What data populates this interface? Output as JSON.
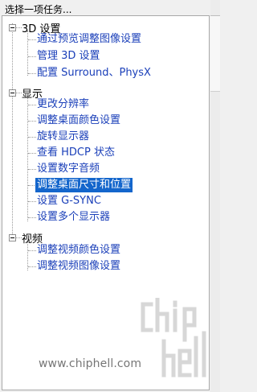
{
  "header": {
    "title": "选择一项任务..."
  },
  "tree": {
    "categories": [
      {
        "label": "3D 设置",
        "items": [
          {
            "label": "通过预览调整图像设置"
          },
          {
            "label": "管理 3D 设置"
          },
          {
            "label": "配置 Surround、PhysX"
          }
        ]
      },
      {
        "label": "显示",
        "items": [
          {
            "label": "更改分辨率"
          },
          {
            "label": "调整桌面颜色设置"
          },
          {
            "label": "旋转显示器"
          },
          {
            "label": "查看 HDCP 状态"
          },
          {
            "label": "设置数字音频"
          },
          {
            "label": "调整桌面尺寸和位置",
            "selected": true
          },
          {
            "label": "设置 G-SYNC"
          },
          {
            "label": "设置多个显示器"
          }
        ]
      },
      {
        "label": "视频",
        "items": [
          {
            "label": "调整视频颜色设置"
          },
          {
            "label": "调整视频图像设置"
          }
        ]
      }
    ]
  },
  "watermark": {
    "url": "www.chiphell.com",
    "logo_text": "chip hell"
  },
  "colors": {
    "link": "#1a3fb9",
    "selection": "#1466cc",
    "background": "#f0f0f0",
    "tree_background": "#ffffff"
  }
}
